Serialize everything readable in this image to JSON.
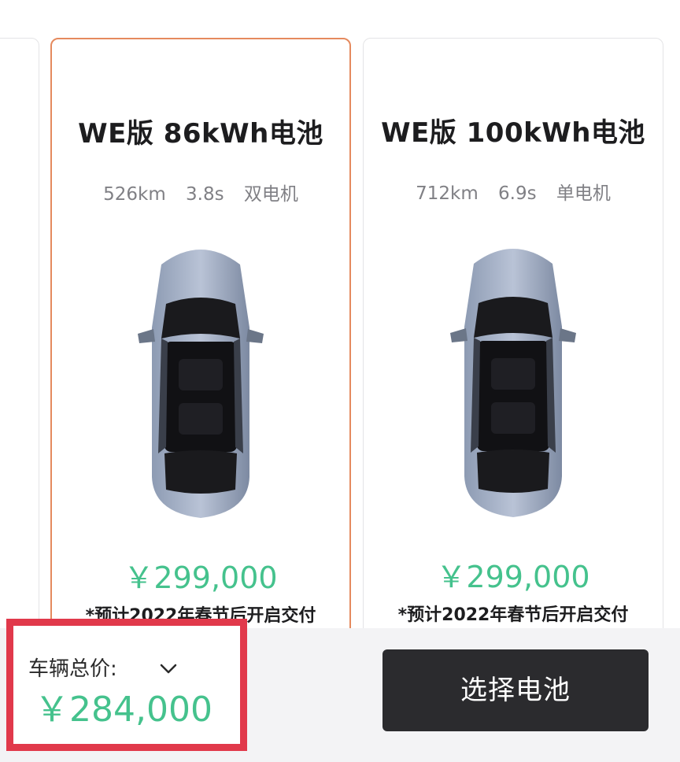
{
  "cards": [
    {
      "title": "WE版 86kWh电池",
      "specs": {
        "range": "526km",
        "accel": "3.8s",
        "motor": "双电机"
      },
      "price": "￥299,000",
      "note": "*预计2022年春节后开启交付",
      "selected": true
    },
    {
      "title": "WE版 100kWh电池",
      "specs": {
        "range": "712km",
        "accel": "6.9s",
        "motor": "单电机"
      },
      "price": "￥299,000",
      "note": "*预计2022年春节后开启交付",
      "selected": false
    }
  ],
  "bottom": {
    "total_label": "车辆总价:",
    "total_price": "￥284,000",
    "cta_label": "选择电池"
  },
  "colors": {
    "accent_green": "#45c28d",
    "selected_border": "#e58a5e",
    "highlight_red": "#e1394b",
    "button_dark": "#2b2b2e"
  },
  "icons": {
    "chevron": "chevron-down-icon",
    "car": "car-top-view-image"
  }
}
